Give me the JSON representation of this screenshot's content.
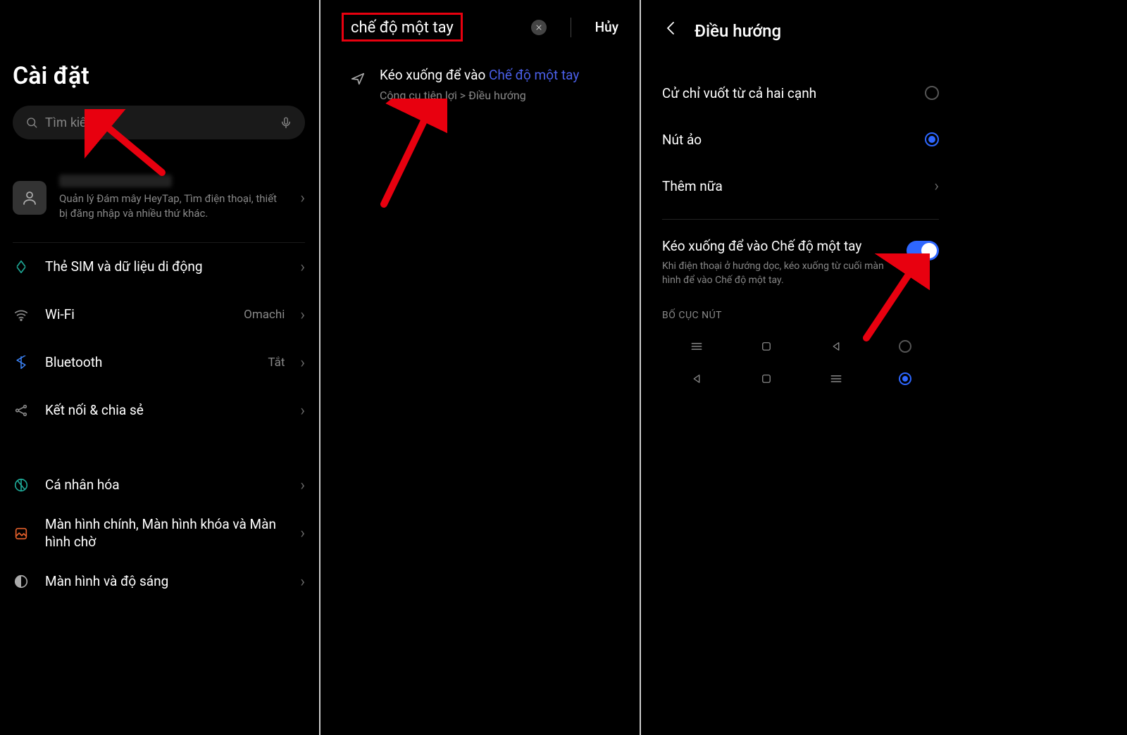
{
  "panel1": {
    "title": "Cài đặt",
    "search_placeholder": "Tìm kiếm",
    "account_sub": "Quản lý Đám mây HeyTap, Tìm điện thoại, thiết bị đăng nhập và nhiều thứ khác.",
    "items": [
      {
        "label": "Thẻ SIM và dữ liệu di động",
        "value": ""
      },
      {
        "label": "Wi-Fi",
        "value": "Omachi"
      },
      {
        "label": "Bluetooth",
        "value": "Tắt"
      },
      {
        "label": "Kết nối & chia sẻ",
        "value": ""
      }
    ],
    "items2": [
      {
        "label": "Cá nhân hóa"
      },
      {
        "label": "Màn hình chính, Màn hình khóa và Màn hình chờ"
      },
      {
        "label": "Màn hình và độ sáng"
      }
    ]
  },
  "panel2": {
    "query": "chế độ một tay",
    "cancel": "Hủy",
    "result_prefix": "Kéo xuống để vào ",
    "result_highlight": "Chế độ một tay",
    "result_path": "Công cụ tiện lợi > Điều hướng"
  },
  "panel3": {
    "title": "Điều hướng",
    "opt_gesture": "Cử chỉ vuốt từ cả hai cạnh",
    "opt_buttons": "Nút ảo",
    "more": "Thêm nữa",
    "toggle_title": "Kéo xuống để vào Chế độ một tay",
    "toggle_desc": "Khi điện thoại ở hướng dọc, kéo xuống từ cuối màn hình để vào Chế độ một tay.",
    "section_layout": "BỐ CỤC NÚT"
  }
}
